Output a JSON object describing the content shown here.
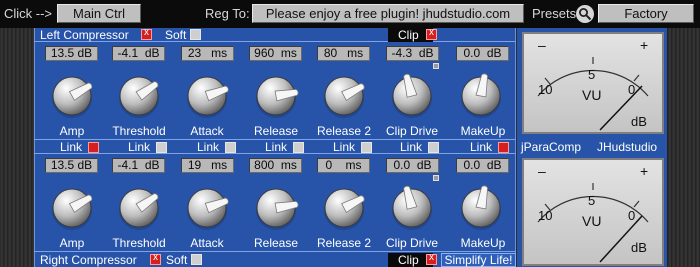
{
  "topbar": {
    "click_label": "Click -->",
    "main_ctrl": "Main Ctrl",
    "reg_to_label": "Reg To:",
    "reg_message": "Please enjoy a free plugin! jhudstudio.com",
    "presets_label": "Presets",
    "preset_value": "Factory"
  },
  "left": {
    "title": "Left Compressor",
    "soft_label": "Soft",
    "clip_label": "Clip",
    "values": [
      "13.5 dB",
      "-4.1  dB",
      "23   ms",
      "960  ms",
      "80   ms",
      "-4.3  dB",
      "0.0  dB"
    ],
    "knob_rotation_deg": [
      60,
      55,
      70,
      80,
      62,
      -15,
      10
    ]
  },
  "link": {
    "labels": [
      "Link",
      "Link",
      "Link",
      "Link",
      "Link",
      "Link",
      "Link"
    ],
    "states": [
      true,
      false,
      false,
      false,
      false,
      false,
      true
    ]
  },
  "right": {
    "title": "Right Compressor",
    "soft_label": "Soft",
    "clip_label": "Clip",
    "values": [
      "13.5 dB",
      "-4.1  dB",
      "19   ms",
      "800  ms",
      "0    ms",
      "0.0  dB",
      "0.0  dB"
    ],
    "knob_rotation_deg": [
      60,
      55,
      70,
      80,
      62,
      -15,
      10
    ]
  },
  "knob_labels": [
    "Amp",
    "Threshold",
    "Attack",
    "Release",
    "Release 2",
    "Clip Drive",
    "MakeUp"
  ],
  "meters": {
    "minus": "–",
    "plus": "+",
    "scale_left": "10",
    "scale_mid": "5",
    "scale_right": "0",
    "unit": "VU",
    "db": "dB"
  },
  "brand": {
    "product": "jParaComp",
    "company": "JHudstudio",
    "slogan": "Simplify Life!"
  }
}
